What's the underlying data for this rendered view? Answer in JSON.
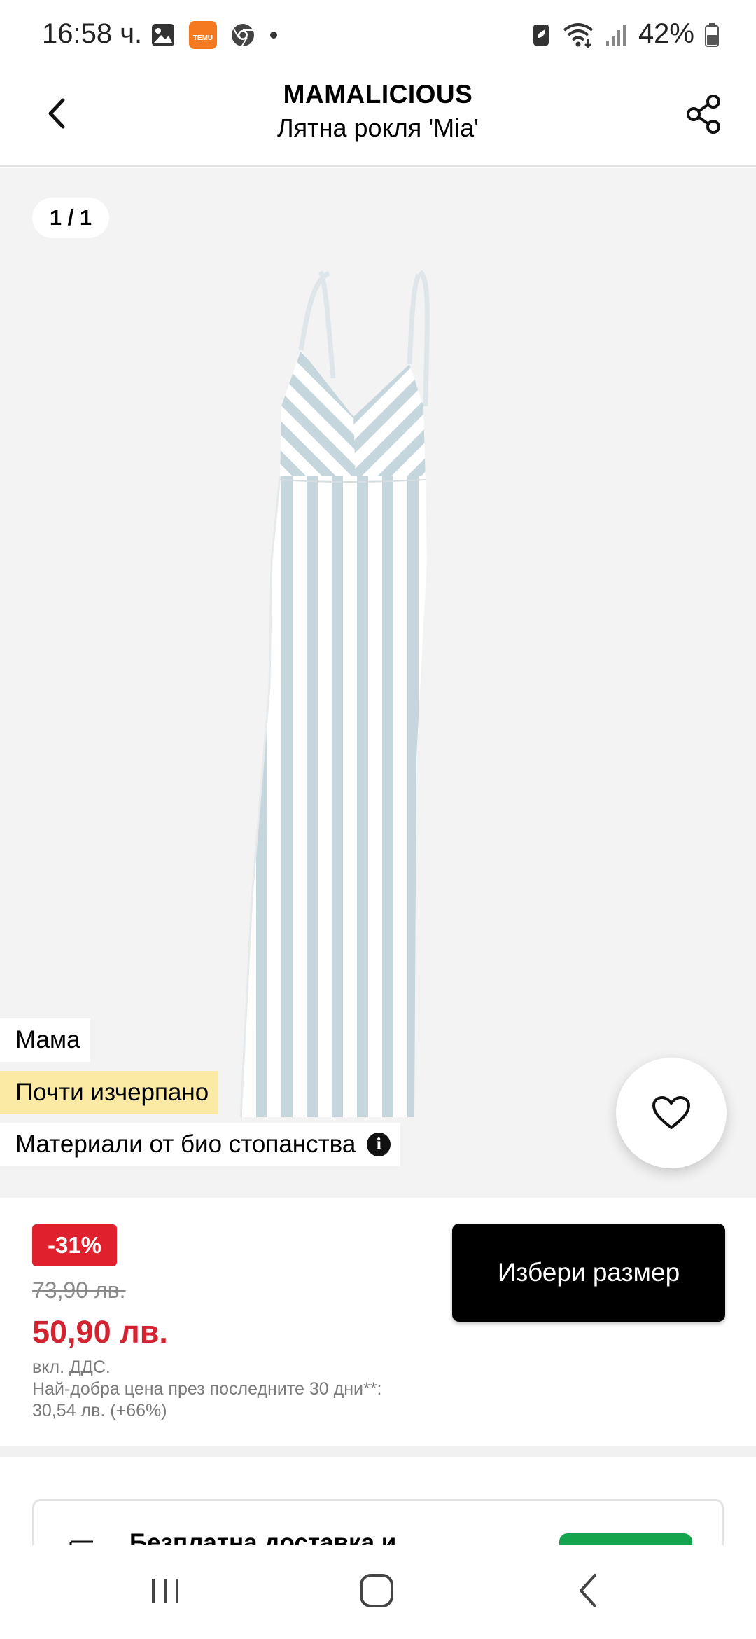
{
  "status_bar": {
    "time": "16:58 ч.",
    "temu_label": "ТЕМU",
    "battery": "42%"
  },
  "header": {
    "brand": "MAMALICIOUS",
    "title": "Лятна рокля 'Mia'"
  },
  "gallery": {
    "counter": "1 / 1",
    "tags": {
      "mama": "Мама",
      "stock": "Почти изчерпано",
      "bio": "Материали от био стопанства"
    }
  },
  "price": {
    "discount": "-31%",
    "old_price": "73,90 лв.",
    "new_price": "50,90 лв.",
    "vat": "вкл. ДДС.",
    "best_price_line1": "Най-добра цена през последните 30 дни**:",
    "best_price_line2": "30,54 лв. (+66%)",
    "select_size": "Избери размер"
  },
  "delivery": {
    "text": "Безплатна доставка и"
  },
  "colors": {
    "accent_red": "#e0202c",
    "price_red": "#d22331",
    "stock_yellow": "#fbeaa3",
    "delivery_green": "#14a44d"
  }
}
